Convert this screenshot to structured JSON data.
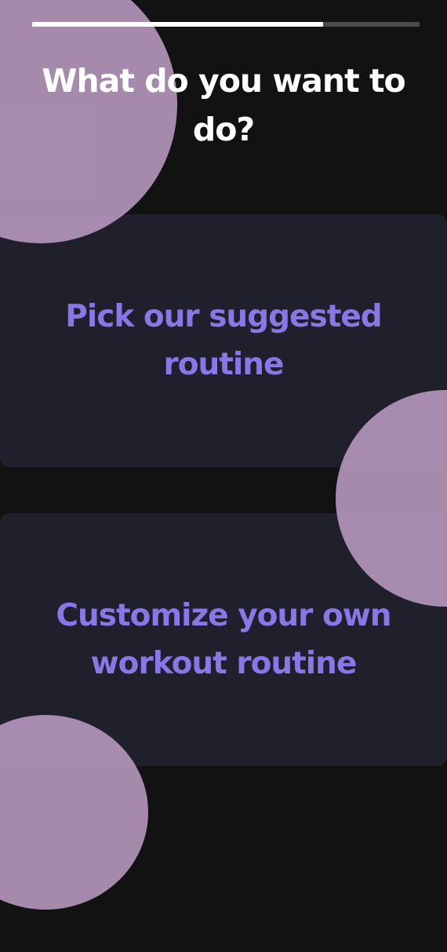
{
  "progress": {
    "value": 0.75,
    "fill_color": "#ffffff",
    "track_color": "#4a4a4a"
  },
  "title": "What do you want to do?",
  "options": [
    {
      "label": "Pick our suggested routine"
    },
    {
      "label": "Customize your own workout routine"
    }
  ],
  "colors": {
    "background": "#121212",
    "card": "#201f2c",
    "accent_text": "#8a76e6",
    "decor_circle": "#c0a0c8"
  }
}
